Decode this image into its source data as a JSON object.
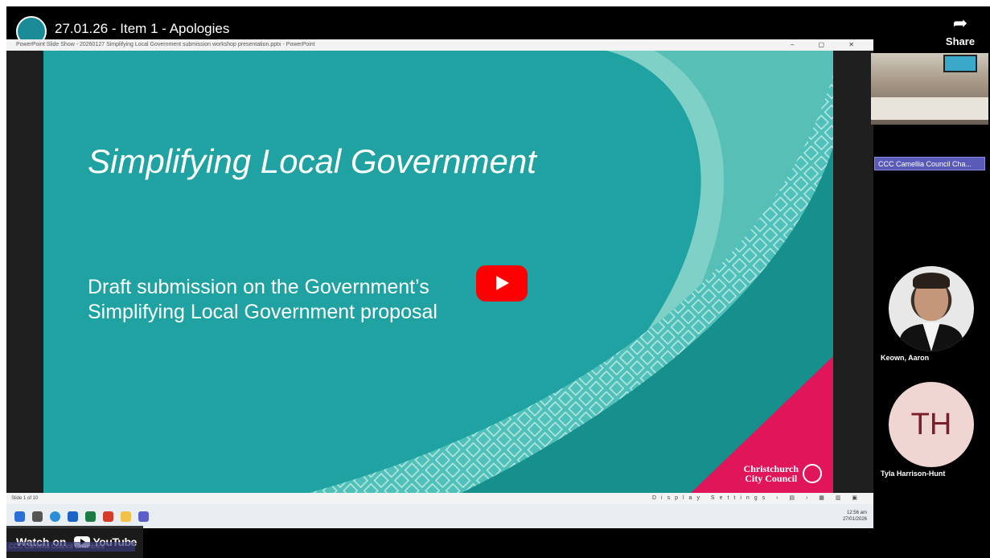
{
  "video": {
    "title": "27.01.26 - Item 1 - Apologies",
    "share_label": "Share",
    "watch_on": "Watch on",
    "youtube_label": "YouTube"
  },
  "ppt": {
    "window_title": "PowerPoint Slide Show - 20260127 Simplifying Local Government submission workshop presentation.pptx - PowerPoint",
    "slide_counter": "Slide 1 of 10",
    "display_settings": "Display Settings",
    "clock_time": "12:56 am",
    "clock_date": "27/01/2026"
  },
  "slide": {
    "title": "Simplifying Local Government",
    "subtitle_line1": "Draft submission on the Government’s",
    "subtitle_line2": "Simplifying Local Government proposal",
    "logo_line1": "Christchurch",
    "logo_line2": "City Council"
  },
  "participants": {
    "room_label": "CCC Camellia Council Cha...",
    "p1_name": "Keown, Aaron",
    "p2_initials": "TH",
    "p2_name": "Tyla Harrison-Hunt",
    "footer_label": "CCC Camellia Council Chambers"
  },
  "colors": {
    "teal": "#1fa2a1",
    "pink": "#e0155a",
    "youtube_red": "#ff0000"
  }
}
